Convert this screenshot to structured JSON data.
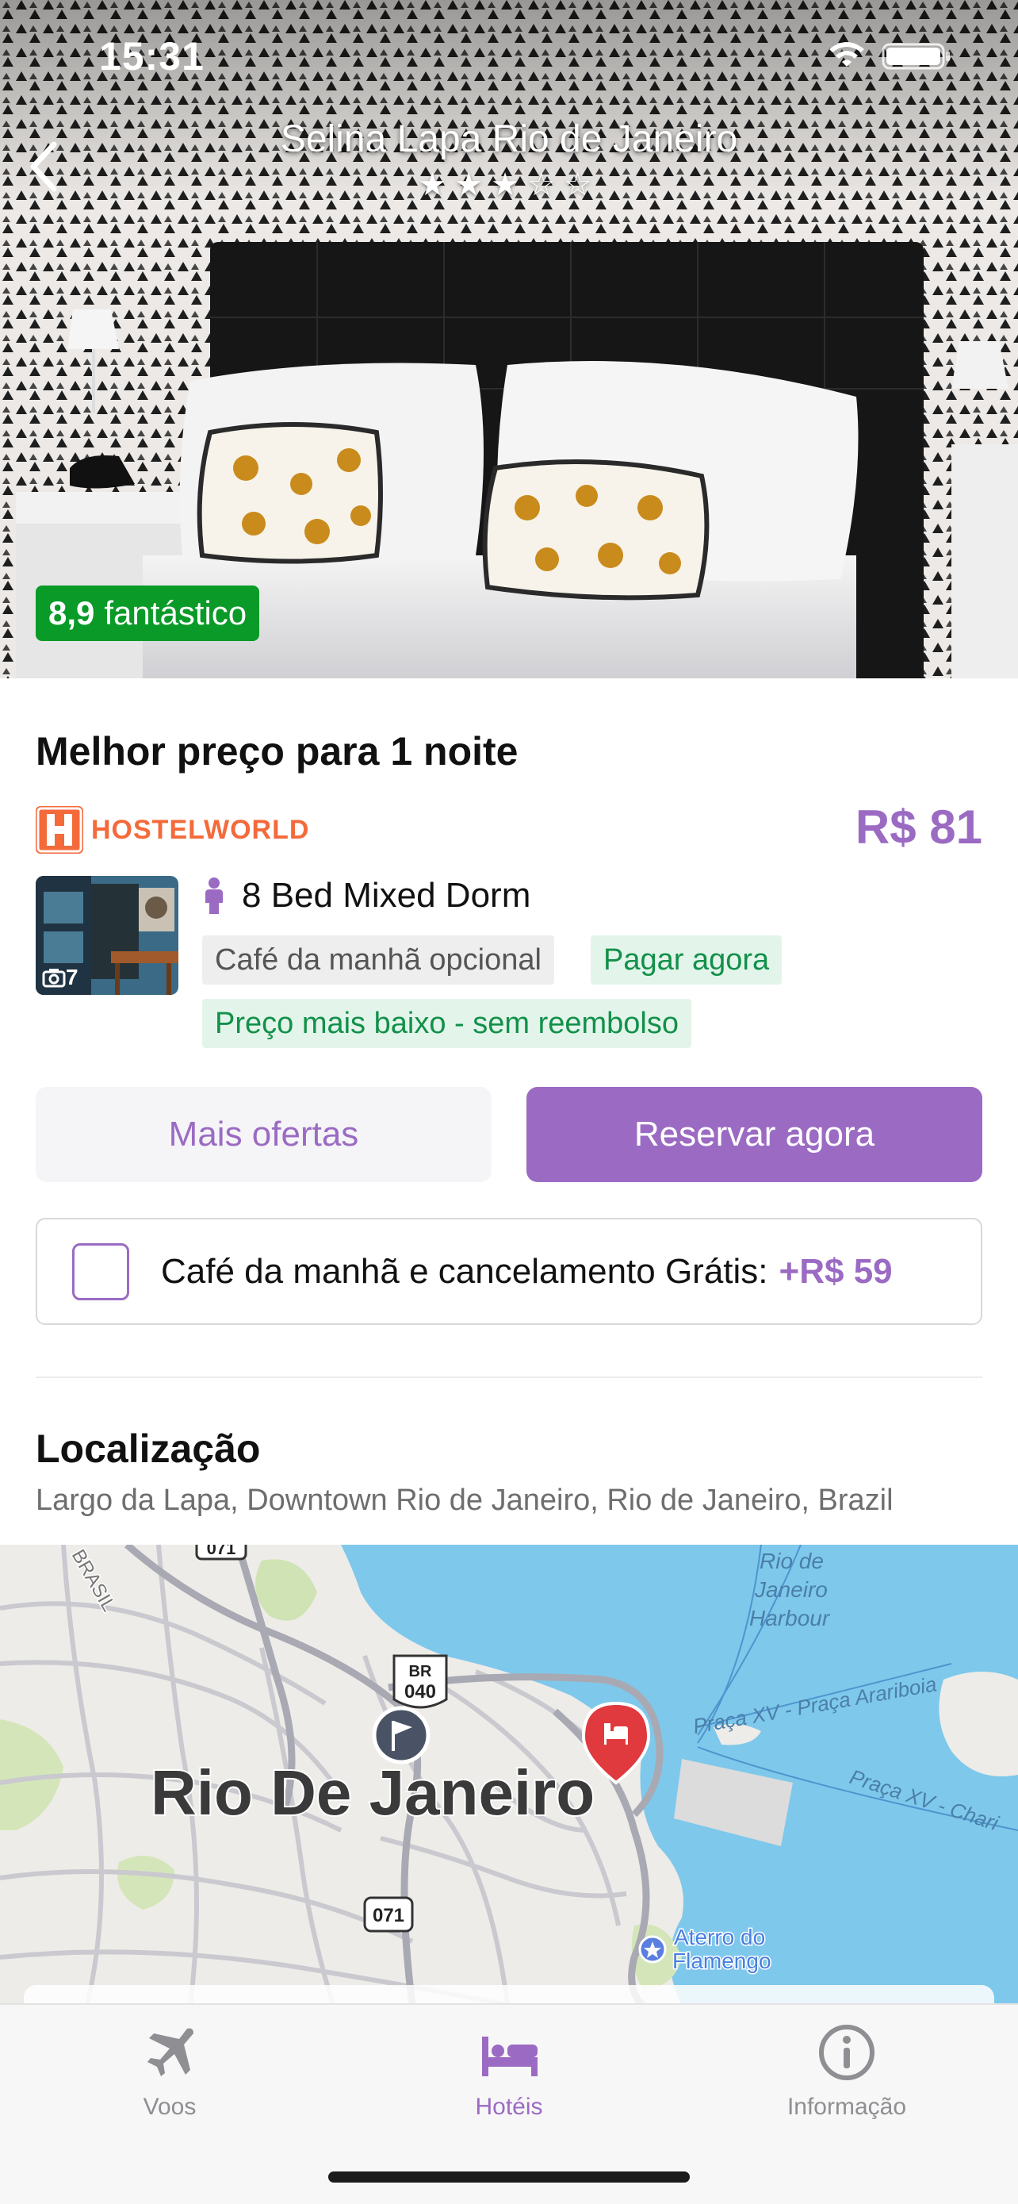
{
  "status_bar": {
    "time": "15:31"
  },
  "header": {
    "hotel_name": "Selina Lapa Rio de Janeiro",
    "stars": "★★★☆☆"
  },
  "rating": {
    "score": "8,9",
    "label": "fantástico"
  },
  "offer": {
    "section_title": "Melhor preço para 1 noite",
    "provider": "HOSTELWORLD",
    "price": "R$ 81",
    "photo_count": "7",
    "room_name": "8 Bed Mixed Dorm",
    "tags": {
      "breakfast": "Café da manhã opcional",
      "pay_now": "Pagar agora",
      "non_refundable": "Preço mais baixo - sem reembolso"
    },
    "more_offers": "Mais ofertas",
    "book_now": "Reservar agora",
    "addon_label": "Café da manhã e cancelamento Grátis:",
    "addon_price": "+R$ 59"
  },
  "location": {
    "title": "Localização",
    "address": "Largo da Lapa, Downtown Rio de Janeiro, Rio de Janeiro, Brazil",
    "map_labels": {
      "city": "Rio De Janeiro",
      "harbour": [
        "Rio de",
        "Janeiro",
        "Harbour"
      ],
      "ferry1": "Praça XV - Praça Arariboia",
      "ferry2": "Praça XV - Chari",
      "park": [
        "Aterro do",
        "Flamengo"
      ],
      "road_br": "BR",
      "road_br_num": "040",
      "road_071": "071",
      "road_071_top": "071",
      "street": "BRASIL"
    }
  },
  "tabbar": {
    "tabs": [
      {
        "label": "Voos",
        "active": false
      },
      {
        "label": "Hotéis",
        "active": true
      },
      {
        "label": "Informação",
        "active": false
      }
    ]
  },
  "colors": {
    "accent": "#9b6bc3",
    "rating_green": "#0a9a28",
    "provider_orange": "#f46a3b",
    "tag_green": "#12904a"
  }
}
